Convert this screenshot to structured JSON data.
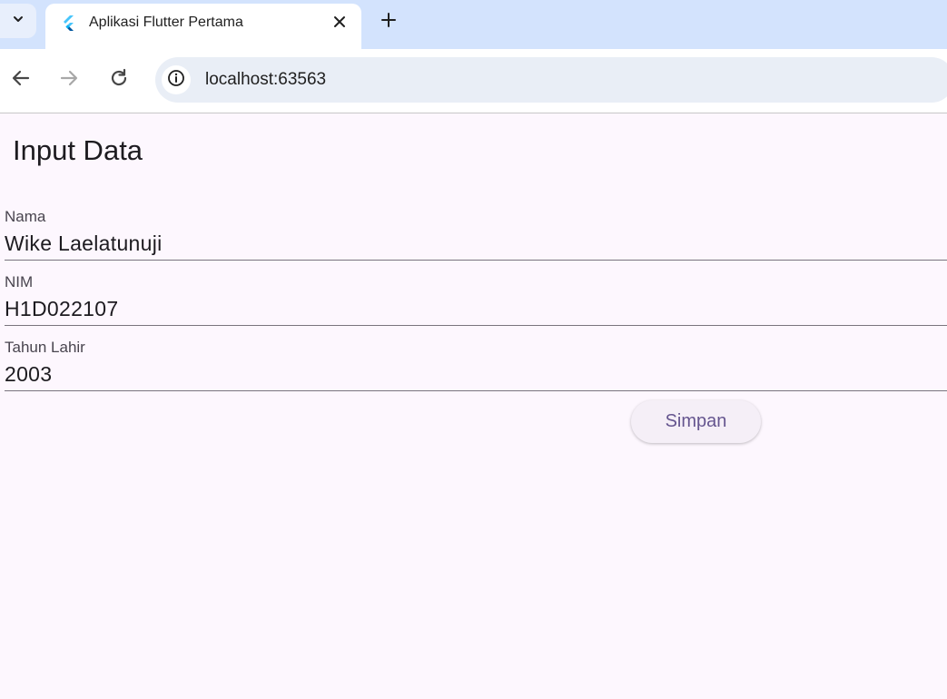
{
  "browser": {
    "tab_title": "Aplikasi Flutter Pertama",
    "url": "localhost:63563",
    "icons": {
      "tab_menu": "chevron-down-icon",
      "favicon": "flutter-icon",
      "close": "close-icon",
      "new_tab": "plus-icon",
      "back": "arrow-left-icon",
      "forward": "arrow-right-icon",
      "reload": "reload-icon",
      "site_info": "info-icon"
    }
  },
  "app": {
    "title": "Input Data",
    "fields": [
      {
        "label": "Nama",
        "value": "Wike Laelatunuji"
      },
      {
        "label": "NIM",
        "value": "H1D022107"
      },
      {
        "label": "Tahun Lahir",
        "value": "2003"
      }
    ],
    "save_label": "Simpan"
  },
  "colors": {
    "background": "#fdf7fe",
    "tabstrip": "#d3e3fd",
    "omnibox": "#e9eef6",
    "button_text": "#65558f",
    "button_bg": "#f5eff7"
  }
}
